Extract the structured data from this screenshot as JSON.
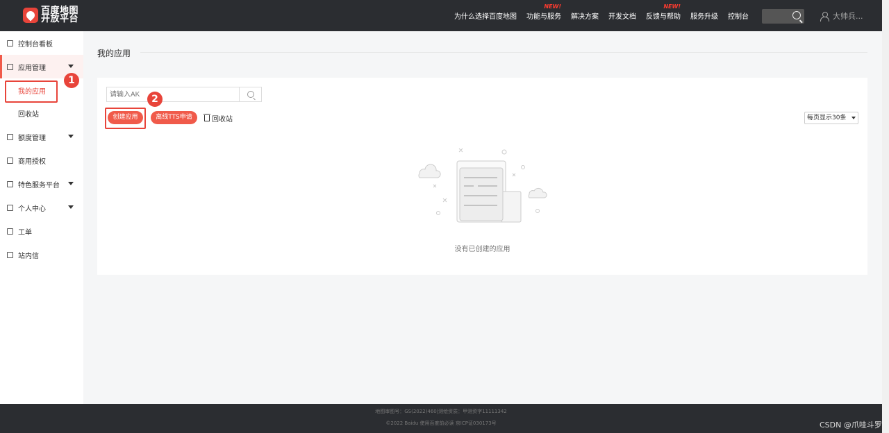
{
  "header": {
    "logo_line1": "百度地图",
    "logo_line2": "开放平台",
    "nav": [
      {
        "label": "为什么选择百度地图",
        "new": ""
      },
      {
        "label": "功能与服务",
        "new": "NEW!"
      },
      {
        "label": "解决方案",
        "new": ""
      },
      {
        "label": "开发文档",
        "new": ""
      },
      {
        "label": "反馈与帮助",
        "new": "NEW!"
      },
      {
        "label": "服务升级",
        "new": ""
      },
      {
        "label": "控制台",
        "new": ""
      }
    ],
    "user_name": "大帅兵..."
  },
  "sidebar": {
    "items": [
      {
        "label": "控制台看板"
      },
      {
        "label": "应用管理"
      },
      {
        "label": "额度管理"
      },
      {
        "label": "商用授权"
      },
      {
        "label": "特色服务平台"
      },
      {
        "label": "个人中心"
      },
      {
        "label": "工单"
      },
      {
        "label": "站内信"
      }
    ],
    "sub_items": [
      {
        "label": "我的应用"
      },
      {
        "label": "回收站"
      }
    ]
  },
  "annotations": {
    "badge1": "1",
    "badge2": "2"
  },
  "main": {
    "title": "我的应用",
    "search_placeholder": "请输入AK",
    "create_button": "创建应用",
    "tts_button": "离线TTS申请",
    "recycle_link": "回收站",
    "page_size": "每页显示30条",
    "empty_text": "没有已创建的应用"
  },
  "footer": {
    "line1": "地图审图号：GS(2022)460|测绘资质：甲测资字11111342",
    "line2": "©2022 Baidu 使用百度前必读 京ICP证030173号"
  },
  "watermark": "CSDN @爪哇斗罗",
  "colors": {
    "accent": "#e8443a",
    "topbar": "#2b2d31"
  }
}
